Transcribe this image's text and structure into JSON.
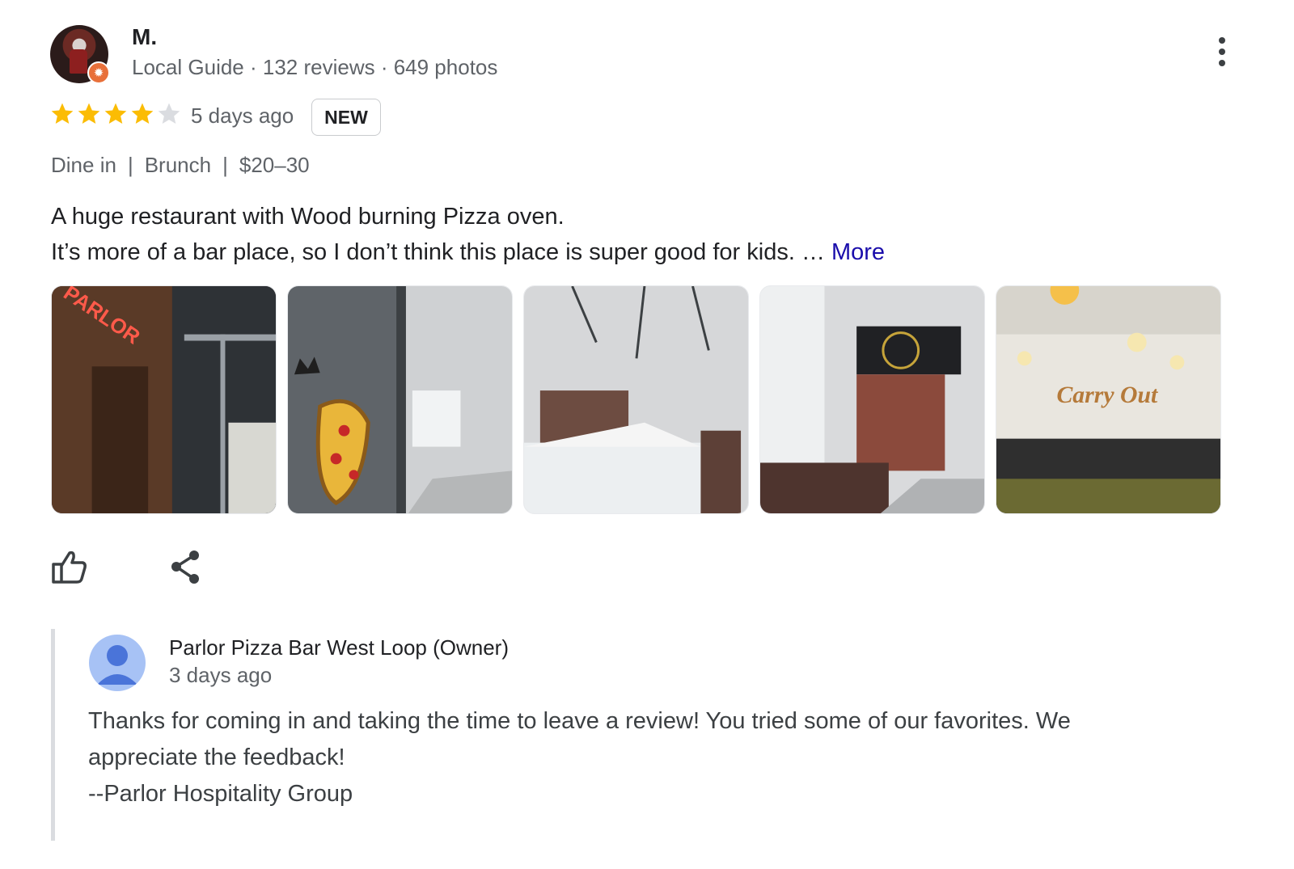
{
  "review": {
    "reviewer_name": "M.",
    "reviewer_meta": "Local Guide · 132 reviews · 649 photos",
    "rating": 4,
    "max_rating": 5,
    "time": "5 days ago",
    "badge": "NEW",
    "tags": [
      "Dine in",
      "Brunch",
      "$20–30"
    ],
    "text_lines": [
      "A huge restaurant with Wood burning Pizza oven.",
      "It’s more of a bar place, so I don’t think this place is super good for kids. …"
    ],
    "more_label": "More",
    "photos": [
      {
        "name": "photo-parlor-sign"
      },
      {
        "name": "photo-pizza-mural"
      },
      {
        "name": "photo-street-tent"
      },
      {
        "name": "photo-pizza-sign"
      },
      {
        "name": "photo-carry-out"
      }
    ],
    "photo_texts": {
      "sign": "PARLOR",
      "carry": "Carry Out"
    }
  },
  "owner_reply": {
    "name": "Parlor Pizza Bar West Loop (Owner)",
    "time": "3 days ago",
    "lines": [
      "Thanks for coming in and taking the time to leave a review! You tried some of our favorites. We",
      "appreciate the feedback!",
      "--Parlor Hospitality Group"
    ]
  },
  "colors": {
    "star_filled": "#fbbc04",
    "star_empty": "#dadce0",
    "link": "#1a0dab",
    "owner_avatar": "#a7c2f5",
    "owner_avatar_icon": "#4a74d9"
  },
  "icons": {
    "menu": "more-vert-icon",
    "like": "thumbs-up-icon",
    "share": "share-icon",
    "badge": "local-guide-badge-icon",
    "owner": "account-avatar-icon"
  }
}
